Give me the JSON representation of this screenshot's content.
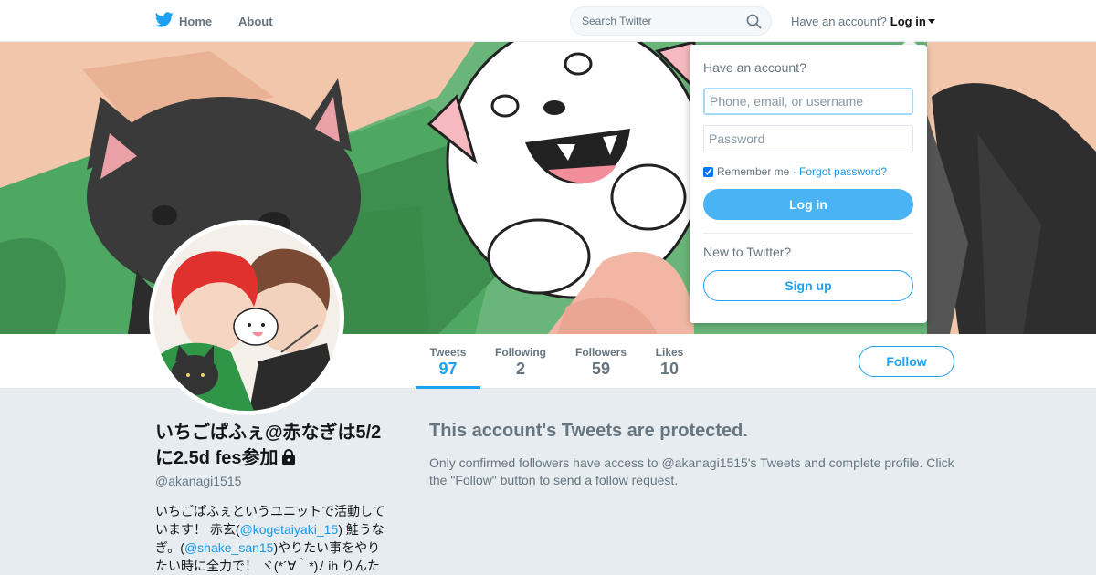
{
  "nav": {
    "home_label": "Home",
    "about_label": "About",
    "search_placeholder": "Search Twitter",
    "have_account": "Have an account?",
    "login_label": "Log in"
  },
  "profile": {
    "name": "いちごぱふぇ@赤なぎは5/2に2.5d fes参加",
    "handle": "@akanagi1515",
    "bio_parts": [
      "いちごぱふぇというユニットで活動しています！ 赤玄(",
      "@kogetaiyaki_15",
      ") 鮭うなぎ。(",
      "@shake_san15",
      ")やりたい事をやりたい時に全力で！ ヾ(*´∀｀*)ﾉ ih りんた"
    ],
    "stats": [
      {
        "label": "Tweets",
        "value": "97"
      },
      {
        "label": "Following",
        "value": "2"
      },
      {
        "label": "Followers",
        "value": "59"
      },
      {
        "label": "Likes",
        "value": "10"
      }
    ],
    "follow_label": "Follow"
  },
  "protected": {
    "title": "This account's Tweets are protected.",
    "body": "Only confirmed followers have access to @akanagi1515's Tweets and complete profile. Click the \"Follow\" button to send a follow request."
  },
  "login_dropdown": {
    "title": "Have an account?",
    "username_placeholder": "Phone, email, or username",
    "password_placeholder": "Password",
    "remember_label": "Remember me",
    "separator": " · ",
    "forgot_label": "Forgot password?",
    "login_button": "Log in",
    "new_label": "New to Twitter?",
    "signup_button": "Sign up"
  },
  "colors": {
    "brand_blue": "#1da1f2",
    "background": "#e6ecf0"
  },
  "icons": [
    "twitter-bird-icon",
    "search-icon",
    "chevron-down-icon",
    "lock-icon"
  ]
}
